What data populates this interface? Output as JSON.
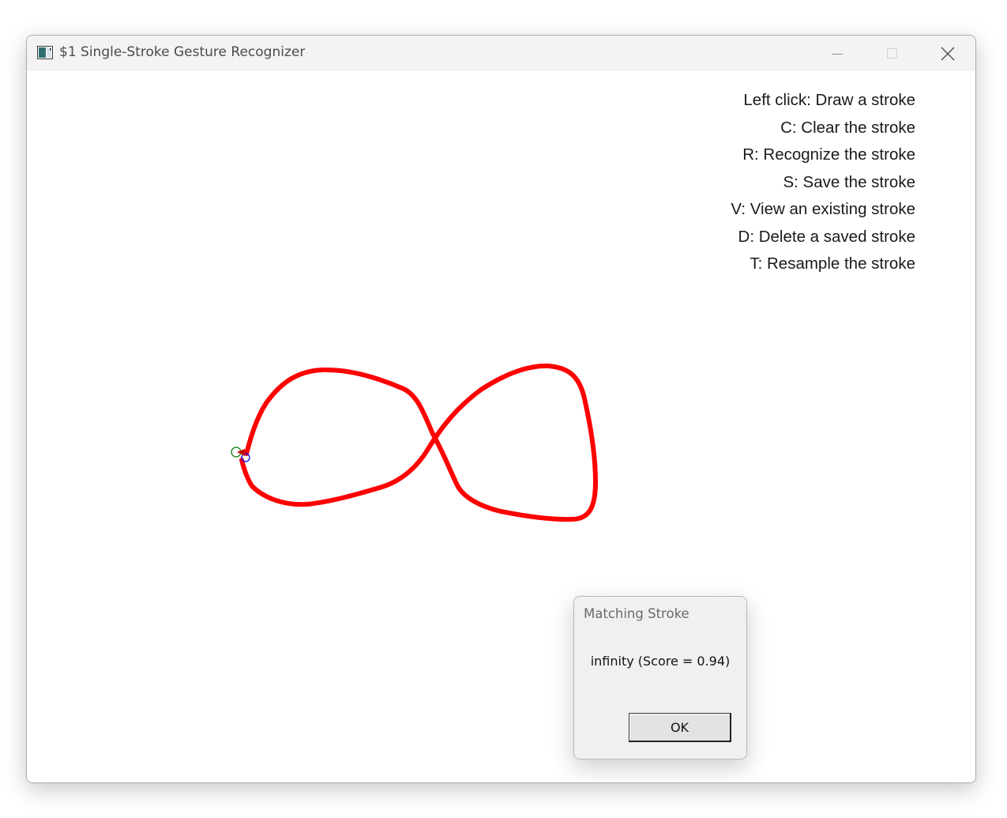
{
  "window": {
    "title": "$1 Single-Stroke Gesture Recognizer",
    "icon": "app-window-icon",
    "controls": [
      "minimize-icon",
      "maximize-icon",
      "close-icon"
    ]
  },
  "help": {
    "lines": [
      "Left click: Draw a stroke",
      "C: Clear the stroke",
      "R: Recognize the stroke",
      "S: Save the stroke",
      "V: View an existing stroke",
      "D: Delete a saved stroke",
      "T: Resample the stroke"
    ]
  },
  "stroke": {
    "color": "#ff0000",
    "shape": "infinity",
    "start_marker_color": "#2e8b2e",
    "end_marker_color": "#0000ff"
  },
  "dialog": {
    "title": "Matching Stroke",
    "message": "infinity (Score = 0.94)",
    "ok_label": "OK"
  }
}
